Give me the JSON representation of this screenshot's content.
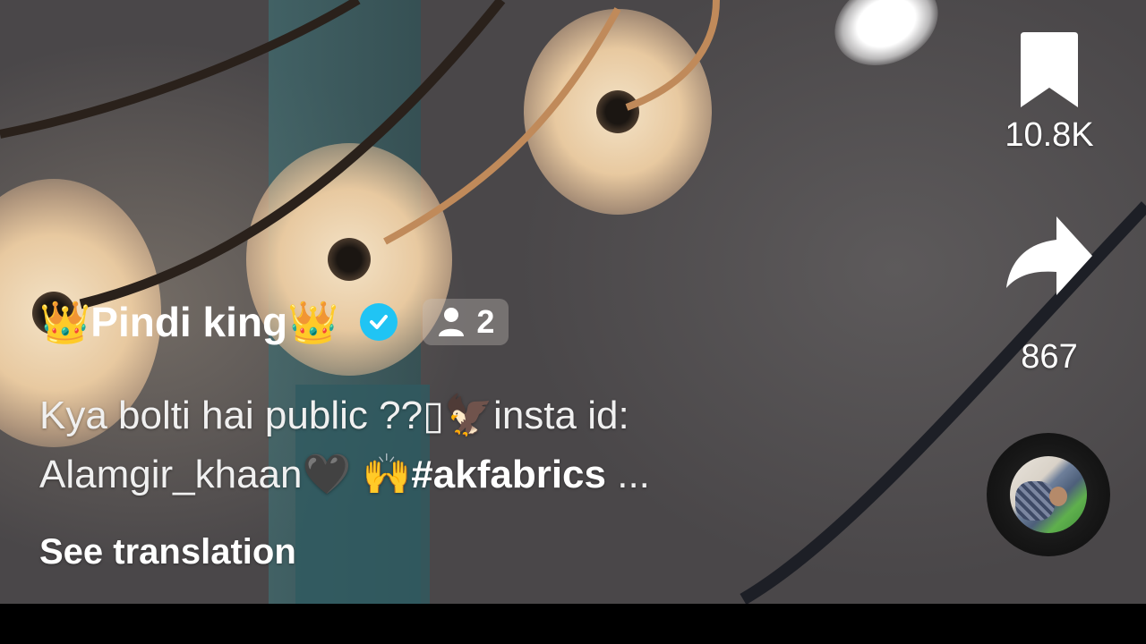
{
  "author": {
    "name": "👑Pindi king👑",
    "verified": true,
    "friends_count": "2"
  },
  "caption": {
    "line1": "Kya bolti hai public ??▯🦅insta id:",
    "line2_text": "Alamgir_khaan🖤 🙌",
    "hashtag": "#akfabrics",
    "ellipsis": " ..."
  },
  "see_translation": "See translation",
  "actions": {
    "favorites_count": "10.8K",
    "shares_count": "867"
  },
  "colors": {
    "verified": "#20c4f4",
    "text": "#ffffff",
    "bottom_bar": "#000000"
  },
  "icons": {
    "favorite": "bookmark-icon",
    "share": "share-arrow-icon",
    "friends": "person-icon",
    "verified": "verified-check-icon",
    "music": "music-disc-icon"
  }
}
